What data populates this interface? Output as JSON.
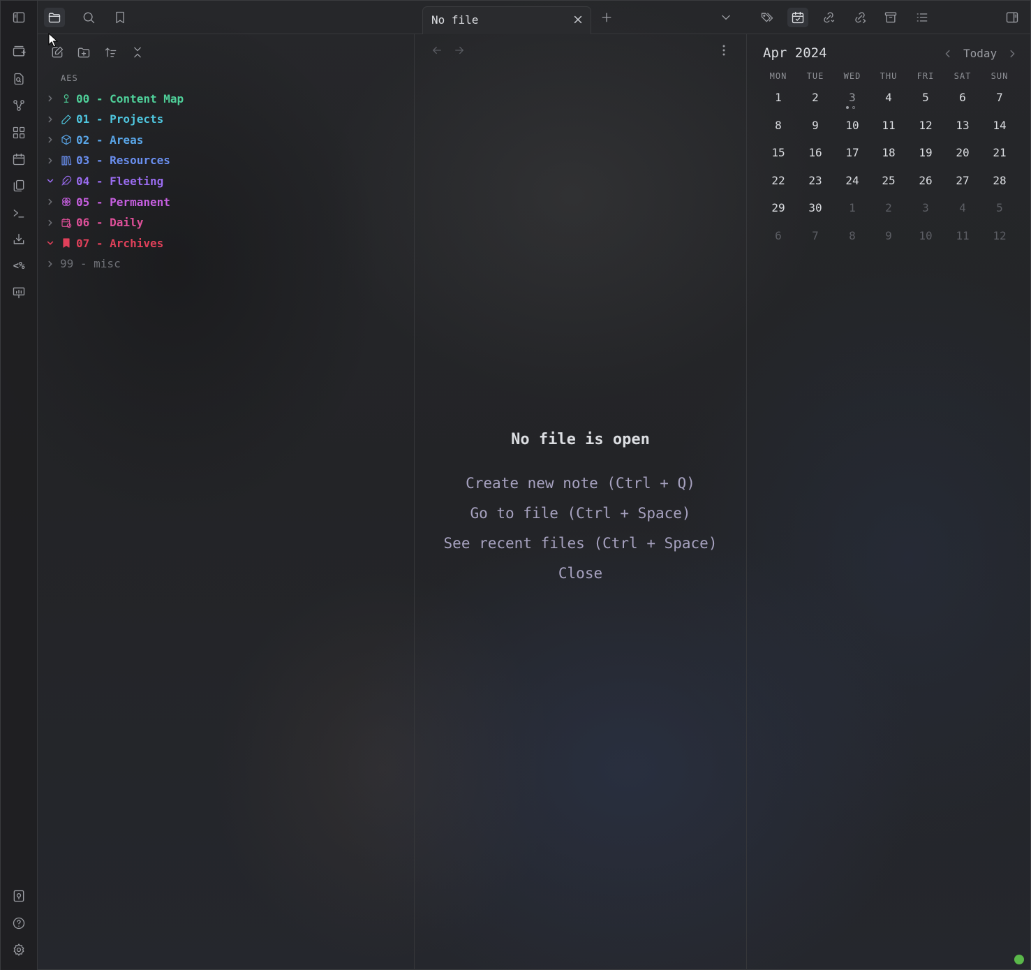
{
  "tab": {
    "title": "No file"
  },
  "explorer": {
    "vault": "AES",
    "folders": [
      {
        "label": "00 - Content Map",
        "color": "#4fd19a",
        "icon": "seedling-icon",
        "expanded": false
      },
      {
        "label": "01 - Projects",
        "color": "#4fc7e0",
        "icon": "pencil-icon",
        "expanded": false
      },
      {
        "label": "02 - Areas",
        "color": "#5aa7ea",
        "icon": "box-icon",
        "expanded": false
      },
      {
        "label": "03 - Resources",
        "color": "#6a8ff0",
        "icon": "library-icon",
        "expanded": false
      },
      {
        "label": "04 - Fleeting",
        "color": "#9a6cf0",
        "icon": "feather-icon",
        "expanded": true
      },
      {
        "label": "05 - Permanent",
        "color": "#c65fe0",
        "icon": "brain-icon",
        "expanded": false
      },
      {
        "label": "06 - Daily",
        "color": "#e0509a",
        "icon": "calendar-clock-icon",
        "expanded": false
      },
      {
        "label": "07 - Archives",
        "color": "#e0405a",
        "icon": "bookmark-icon",
        "expanded": true
      },
      {
        "label": "99 - misc",
        "color": "#6e7076",
        "icon": "",
        "expanded": false
      }
    ]
  },
  "editor": {
    "empty_title": "No file is open",
    "actions": [
      "Create new note (Ctrl + Q)",
      "Go to file (Ctrl + Space)",
      "See recent files (Ctrl + Space)",
      "Close"
    ]
  },
  "calendar": {
    "month": "Apr",
    "year": "2024",
    "today_label": "Today",
    "weekdays": [
      "MON",
      "TUE",
      "WED",
      "THU",
      "FRI",
      "SAT",
      "SUN"
    ],
    "weeks": [
      [
        "1",
        "2",
        "3",
        "4",
        "5",
        "6",
        "7"
      ],
      [
        "8",
        "9",
        "10",
        "11",
        "12",
        "13",
        "14"
      ],
      [
        "15",
        "16",
        "17",
        "18",
        "19",
        "20",
        "21"
      ],
      [
        "22",
        "23",
        "24",
        "25",
        "26",
        "27",
        "28"
      ],
      [
        "29",
        "30",
        "1",
        "2",
        "3",
        "4",
        "5"
      ],
      [
        "6",
        "7",
        "8",
        "9",
        "10",
        "11",
        "12"
      ]
    ],
    "adjacent_from_index": 30
  },
  "colors": {
    "accent": "#a7a2c0",
    "status": "#5ab84a"
  }
}
